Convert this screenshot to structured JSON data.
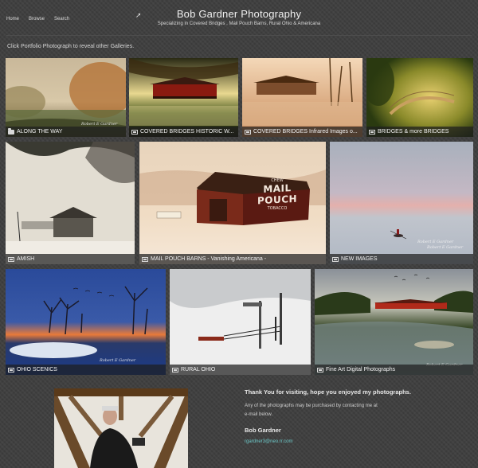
{
  "nav": {
    "home": "Home",
    "browse": "Browse",
    "search": "Search"
  },
  "header": {
    "title": "Bob Gardner Photography",
    "subtitle": "Specializing in Covered Bridges , Mail Pouch Barns, Rural Ohio & Americana"
  },
  "intro": "Click Portfolio Photograph  to reveal other Galleries.",
  "tiles": [
    {
      "label": "ALONG THE WAY",
      "icon": "folder-icon"
    },
    {
      "label": "COVERED BRIDGES HISTORIC W...",
      "icon": "gallery-icon"
    },
    {
      "label": "COVERED BRIDGES Infrared Images o...",
      "icon": "gallery-icon"
    },
    {
      "label": "BRIDGES & more BRIDGES",
      "icon": "gallery-icon"
    },
    {
      "label": "AMISH",
      "icon": "gallery-icon"
    },
    {
      "label": "MAIL POUCH BARNS - Vanishing Americana -",
      "icon": "gallery-icon"
    },
    {
      "label": "NEW IMAGES",
      "icon": "gallery-icon"
    },
    {
      "label": "OHIO SCENICS",
      "icon": "gallery-icon"
    },
    {
      "label": "RURAL OHIO",
      "icon": "gallery-icon"
    },
    {
      "label": "Fine Art Digital Photographs",
      "icon": "gallery-icon"
    }
  ],
  "signature": "Robert E Gardner",
  "barn_sign": {
    "line1": "CHEW",
    "line2": "MAIL POUCH",
    "line3": "TOBACCO"
  },
  "footer": {
    "thanks": "Thank You for visiting, hope you enjoyed  my photographs.",
    "line1": "Any of the photographs may be purchased by contacting me at",
    "line2": "e-mail below.",
    "name": "Bob Gardner",
    "email": "rgardner3@neo.rr.com"
  }
}
